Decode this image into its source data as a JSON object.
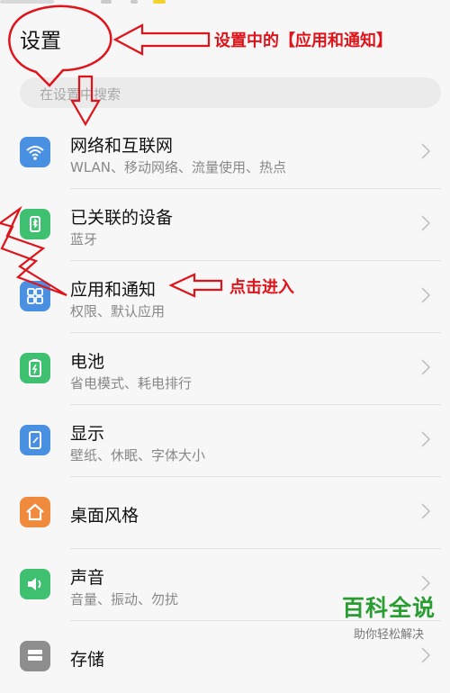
{
  "header": {
    "title": "设置"
  },
  "search": {
    "placeholder": "在设置中搜索"
  },
  "items": [
    {
      "title": "网络和互联网",
      "subtitle": "WLAN、移动网络、流量使用、热点",
      "icon": "wifi-icon",
      "color": "#4a90e2"
    },
    {
      "title": "已关联的设备",
      "subtitle": "蓝牙",
      "icon": "device-link-icon",
      "color": "#3fbf70"
    },
    {
      "title": "应用和通知",
      "subtitle": "权限、默认应用",
      "icon": "apps-icon",
      "color": "#4a90e2"
    },
    {
      "title": "电池",
      "subtitle": "省电模式、耗电排行",
      "icon": "battery-icon",
      "color": "#3fbf70"
    },
    {
      "title": "显示",
      "subtitle": "壁纸、休眠、字体大小",
      "icon": "display-icon",
      "color": "#4a90e2"
    },
    {
      "title": "桌面风格",
      "subtitle": "",
      "icon": "home-icon",
      "color": "#f08a3c"
    },
    {
      "title": "声音",
      "subtitle": "音量、振动、勿扰",
      "icon": "sound-icon",
      "color": "#3fbf70"
    },
    {
      "title": "存储",
      "subtitle": "",
      "icon": "storage-icon",
      "color": "#8e8e8e"
    }
  ],
  "annotations": {
    "top": "设置中的【应用和通知】",
    "click": "点击进入"
  },
  "watermark": {
    "brand": "百科全说",
    "slogan": "助你轻松解决"
  },
  "colors": {
    "annotation": "#e0131a",
    "watermark": "#2a9d32"
  }
}
